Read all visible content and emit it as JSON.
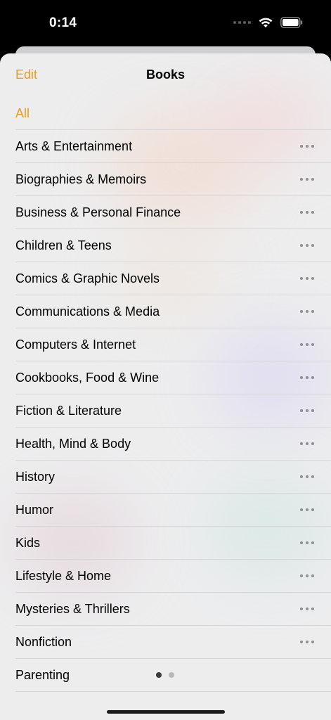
{
  "status_bar": {
    "time": "0:14"
  },
  "nav": {
    "edit_label": "Edit",
    "title": "Books"
  },
  "list": {
    "items": [
      {
        "label": "All",
        "selected": true
      },
      {
        "label": "Arts & Entertainment"
      },
      {
        "label": "Biographies & Memoirs"
      },
      {
        "label": "Business & Personal Finance"
      },
      {
        "label": "Children & Teens"
      },
      {
        "label": "Comics & Graphic Novels"
      },
      {
        "label": "Communications & Media"
      },
      {
        "label": "Computers & Internet"
      },
      {
        "label": "Cookbooks, Food & Wine"
      },
      {
        "label": "Fiction & Literature"
      },
      {
        "label": "Health, Mind & Body"
      },
      {
        "label": "History"
      },
      {
        "label": "Humor"
      },
      {
        "label": "Kids"
      },
      {
        "label": "Lifestyle & Home"
      },
      {
        "label": "Mysteries & Thrillers"
      },
      {
        "label": "Nonfiction"
      },
      {
        "label": "Parenting"
      }
    ]
  },
  "page_indicator": {
    "current": 1,
    "total": 2
  },
  "icons": {
    "row_action": "more-icon",
    "wifi": "wifi-icon",
    "battery": "battery-icon"
  },
  "colors": {
    "accent": "#f09a1e",
    "text": "#000000",
    "separator": "#d6d6d8"
  }
}
